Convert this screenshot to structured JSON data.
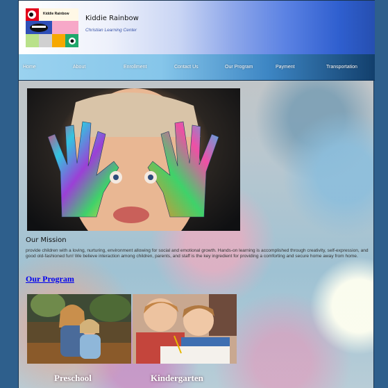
{
  "header": {
    "brand_name": "Kiddie Rainbow",
    "brand_sub": "Christian Learning Center",
    "logo_text": "Kiddie Rainbow"
  },
  "nav": {
    "items": [
      {
        "label": "Home"
      },
      {
        "label": "About"
      },
      {
        "label": "Enrollment"
      },
      {
        "label": "Contact Us"
      },
      {
        "label": "Our Program"
      },
      {
        "label": "Payment"
      },
      {
        "label": "Transportation"
      }
    ]
  },
  "mission": {
    "title": "Our Mission",
    "text": "provide children with a loving, nurturing, environment allowing for social and emotional growth. Hands-on learning is accomplished through creativity, self-expression, and good old-fashioned fun! We believe interaction among children, parents, and staff is the key ingredient for providing a comforting and secure home away from home."
  },
  "program": {
    "link_label": "Our Program",
    "cards": [
      {
        "label": "Preschool"
      },
      {
        "label": "Kindergarten"
      }
    ]
  },
  "colors": {
    "nav_start": "#9ad2ef",
    "nav_end": "#123f6c",
    "link": "#0000ee",
    "page_bg": "#2e5f8c"
  }
}
